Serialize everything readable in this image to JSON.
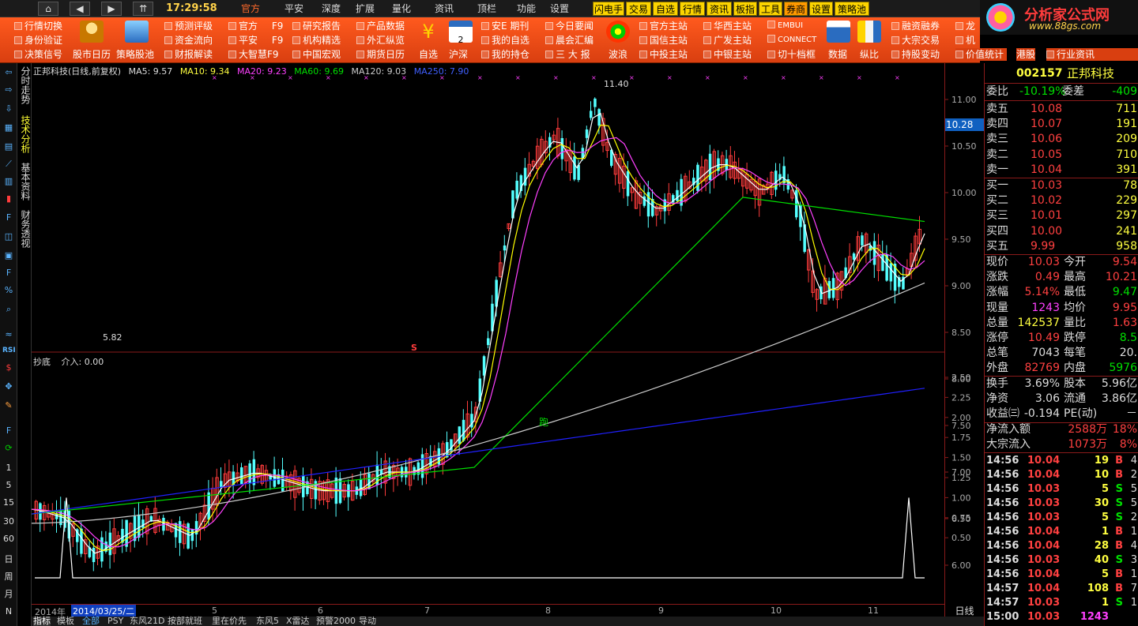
{
  "topbar": {
    "nav": [
      "⌂",
      "◀",
      "▶",
      "⇈"
    ],
    "clock": "17:29:58",
    "menu": [
      "官方",
      "平安",
      "深度",
      "扩展",
      "量化",
      "资讯",
      "顶栏",
      "功能",
      "设置"
    ],
    "quick": [
      "闪电手",
      "交易",
      "自选",
      "行情",
      "资讯",
      "板指",
      "工具",
      "券商",
      "设置",
      "策略池"
    ]
  },
  "logo": {
    "title": "分析家公式网",
    "url": "www.88gs.com"
  },
  "toolbar": {
    "col1": [
      "行情切换",
      "身份验证",
      "决策信号"
    ],
    "col2a": "股市日历",
    "col2b": "策略股池",
    "col3": [
      "预测评级",
      "资金流向",
      "财报解读"
    ],
    "col4": [
      "官方",
      "平安",
      "大智慧"
    ],
    "col4k": [
      "F9",
      "F9",
      "F9"
    ],
    "col5": [
      "研究报告",
      "机构精选",
      "中国宏观"
    ],
    "col6": [
      "产品数据",
      "外汇纵览",
      "期货日历"
    ],
    "col7": "自选",
    "col8": "沪深",
    "col9": [
      "安E 期刊",
      "我的自选",
      "我的持仓"
    ],
    "col10": [
      "今日要闻",
      "晨会汇编",
      "三 大 报"
    ],
    "col11": "波浪",
    "col12": [
      "官方主站",
      "国信主站",
      "中投主站"
    ],
    "col13": [
      "华西主站",
      "广发主站",
      "中银主站"
    ],
    "col14": [
      "EMBUI",
      "CONNECT",
      "切十档框"
    ],
    "col15": "数据",
    "col16": "纵比",
    "col17": [
      "融资融券",
      "大宗交易",
      "持股变动"
    ],
    "col18": [
      "龙",
      "机",
      "价值统计"
    ],
    "col19": "港股",
    "col20": "行业资讯"
  },
  "leftbar": {
    "nums": [
      "1",
      "5",
      "15",
      "30",
      "60",
      "日",
      "周",
      "月",
      "N"
    ],
    "rsi": "RSI"
  },
  "vtabs": [
    "分时走势",
    "技术分析",
    "基本资料",
    "财务透视"
  ],
  "legend": {
    "name": "正邦科技(日线,前复权)",
    "ma5": "MA5: 9.57",
    "ma10": "MA10: 9.34",
    "ma20": "MA20: 9.23",
    "ma60": "MA60: 9.69",
    "ma120": "MA120: 9.03",
    "ma250": "MA250: 7.90"
  },
  "markers": {
    "high": "11.40",
    "low": "5.82",
    "price_tag": "10.28",
    "s": "S",
    "pao": "跑"
  },
  "indicator": {
    "name": "抄底",
    "value": "介入: 0.00"
  },
  "yaxis_main": [
    "11.00",
    "10.50",
    "10.00",
    "9.50",
    "9.00",
    "8.50",
    "8.00",
    "7.50",
    "7.00",
    "6.50",
    "6.00"
  ],
  "yaxis_ind": [
    "2.50",
    "2.25",
    "2.00",
    "1.75",
    "1.50",
    "1.25",
    "1.00",
    "0.75",
    "0.50"
  ],
  "datebar": {
    "year": "2014年",
    "date": "2014/03/25/二",
    "months": [
      "5",
      "6",
      "7",
      "8",
      "9",
      "10",
      "11"
    ],
    "period": "日线"
  },
  "tabs": [
    "指标",
    "模板",
    "全部",
    "PSY",
    "东风21D",
    "按部就班",
    "里在价先",
    "东风5",
    "X雷达",
    "预警2000",
    "导动"
  ],
  "stock": {
    "code": "002157",
    "name": "正邦科技"
  },
  "weibi": {
    "label": "委比",
    "value": "-10.19%",
    "label2": "委差",
    "value2": "-409"
  },
  "asks": [
    [
      "卖五",
      "10.08",
      "711"
    ],
    [
      "卖四",
      "10.07",
      "191"
    ],
    [
      "卖三",
      "10.06",
      "209"
    ],
    [
      "卖二",
      "10.05",
      "710"
    ],
    [
      "卖一",
      "10.04",
      "391"
    ]
  ],
  "bids": [
    [
      "买一",
      "10.03",
      "78"
    ],
    [
      "买二",
      "10.02",
      "229"
    ],
    [
      "买三",
      "10.01",
      "297"
    ],
    [
      "买四",
      "10.00",
      "241"
    ],
    [
      "买五",
      "9.99",
      "958"
    ]
  ],
  "quote": [
    [
      "现价",
      "10.03",
      "今开",
      "9.54"
    ],
    [
      "涨跌",
      "0.49",
      "最高",
      "10.21"
    ],
    [
      "涨幅",
      "5.14%",
      "最低",
      "9.47"
    ],
    [
      "现量",
      "1243",
      "均价",
      "9.95"
    ],
    [
      "总量",
      "142537",
      "量比",
      "1.63"
    ],
    [
      "涨停",
      "10.49",
      "跌停",
      "8.5"
    ],
    [
      "总笔",
      "7043",
      "每笔",
      "20."
    ],
    [
      "外盘",
      "82769",
      "内盘",
      "5976"
    ]
  ],
  "quote2": [
    [
      "换手",
      "3.69%",
      "股本",
      "5.96亿"
    ],
    [
      "净资",
      "3.06",
      "流通",
      "3.86亿"
    ],
    [
      "收益㈢",
      "-0.194",
      "PE(动)",
      "－"
    ]
  ],
  "flow": [
    [
      "净流入额",
      "2588万",
      "18%"
    ],
    [
      "大宗流入",
      "1073万",
      "8%"
    ]
  ],
  "ticks": [
    [
      "14:56",
      "10.04",
      "19",
      "B",
      "4"
    ],
    [
      "14:56",
      "10.04",
      "10",
      "B",
      "2"
    ],
    [
      "14:56",
      "10.03",
      "5",
      "S",
      "5"
    ],
    [
      "14:56",
      "10.03",
      "30",
      "S",
      "5"
    ],
    [
      "14:56",
      "10.03",
      "5",
      "S",
      "2"
    ],
    [
      "14:56",
      "10.04",
      "1",
      "B",
      "1"
    ],
    [
      "14:56",
      "10.04",
      "28",
      "B",
      "4"
    ],
    [
      "14:56",
      "10.03",
      "40",
      "S",
      "3"
    ],
    [
      "14:56",
      "10.04",
      "5",
      "B",
      "1"
    ],
    [
      "14:57",
      "10.04",
      "108",
      "B",
      "7"
    ],
    [
      "14:57",
      "10.03",
      "1",
      "S",
      "1"
    ],
    [
      "15:00",
      "10.03",
      "1243",
      "",
      ""
    ]
  ],
  "colors": {
    "up": "#ff3c3c",
    "down": "#54ffff",
    "ma5": "#ffffff",
    "ma10": "#ffff00",
    "ma20": "#ff40ff",
    "ma60": "#00e000",
    "ma120": "#cccccc",
    "ma250": "#2020ff",
    "signal": "#ffffff"
  }
}
